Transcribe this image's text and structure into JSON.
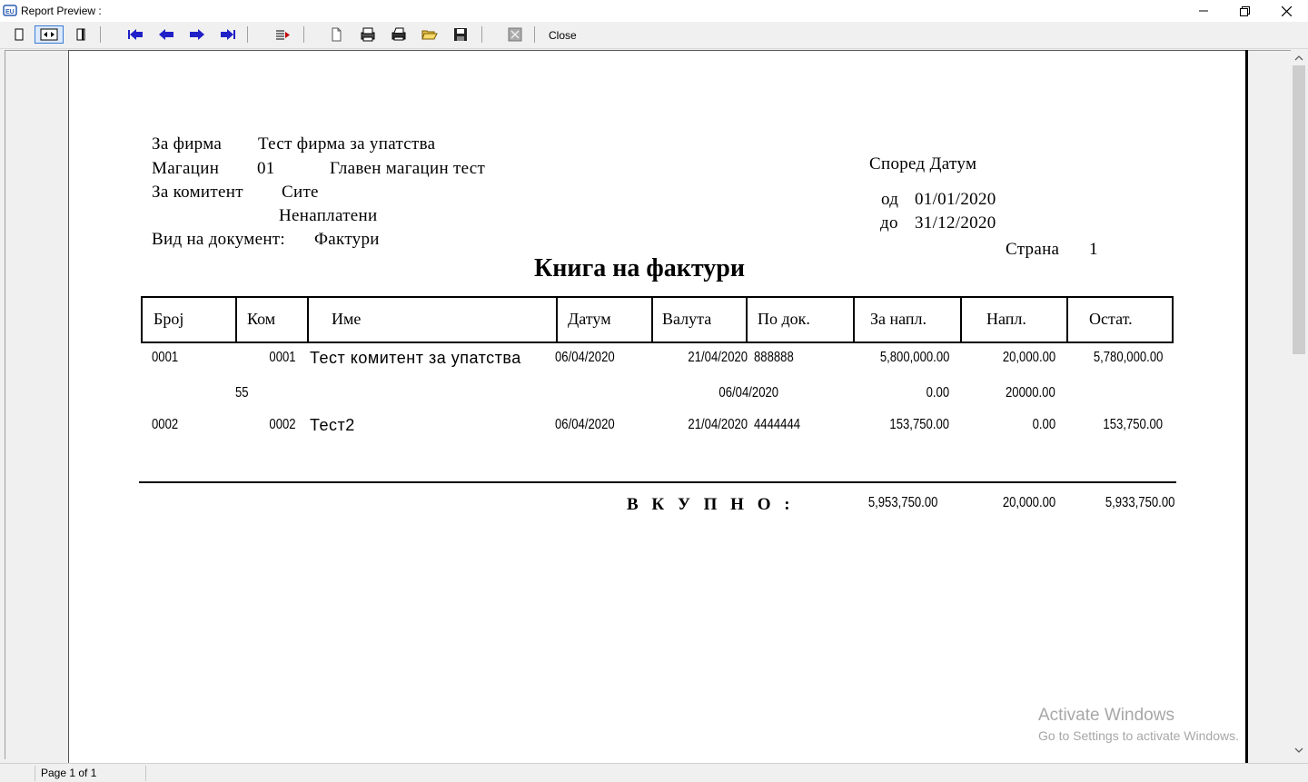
{
  "window": {
    "title": "Report Preview :"
  },
  "toolbar": {
    "close_label": "Close",
    "icons": [
      "one-page-icon",
      "fit-width-icon",
      "two-page-icon",
      "first-page-icon",
      "prev-page-icon",
      "next-page-icon",
      "last-page-icon",
      "goto-page-icon",
      "page-setup-icon",
      "printer-setup-icon",
      "print-icon",
      "open-icon",
      "save-icon",
      "zoom-icon"
    ]
  },
  "status": {
    "page": "Page 1 of 1"
  },
  "report": {
    "company_label": "За фирма",
    "company_value": "Тест фирма за упатства",
    "warehouse_label": "Магацин",
    "warehouse_code": "01",
    "warehouse_name": "Главен магацин тест",
    "client_label": "За комитент",
    "client_value": "Сите",
    "status_value": "Ненаплатени",
    "doc_type_label": "Вид на документ:",
    "doc_type_value": "Фактури",
    "sort_label": "Според Датум",
    "from_label": "од",
    "from_value": "01/01/2020",
    "to_label": "до",
    "to_value": "31/12/2020",
    "page_label": "Страна",
    "page_value": "1",
    "title": "Книга на фактури",
    "columns": [
      "Број",
      "Ком",
      "Име",
      "Датум",
      "Валута",
      "По док.",
      "За напл.",
      "Напл.",
      "Остат."
    ],
    "rows": [
      {
        "broj": "0001",
        "kom": "0001",
        "ime": "Тест комитент за упатства",
        "datum": "06/04/2020",
        "valuta": "21/04/2020",
        "po_dok": "888888",
        "za_napl": "5,800,000.00",
        "napl": "20,000.00",
        "ostat": "5,780,000.00"
      },
      {
        "sub": "55",
        "datum2": "06/04/2020",
        "za_napl": "0.00",
        "napl": "20000.00"
      },
      {
        "broj": "0002",
        "kom": "0002",
        "ime": "Тест2",
        "datum": "06/04/2020",
        "valuta": "21/04/2020",
        "po_dok": "4444444",
        "za_napl": "153,750.00",
        "napl": "0.00",
        "ostat": "153,750.00"
      }
    ],
    "total_label": "В К У П Н О :",
    "total_za_napl": "5,953,750.00",
    "total_napl": "20,000.00",
    "total_ostat": "5,933,750.00"
  },
  "watermark": {
    "line1": "Activate Windows",
    "line2": "Go to Settings to activate Windows."
  }
}
